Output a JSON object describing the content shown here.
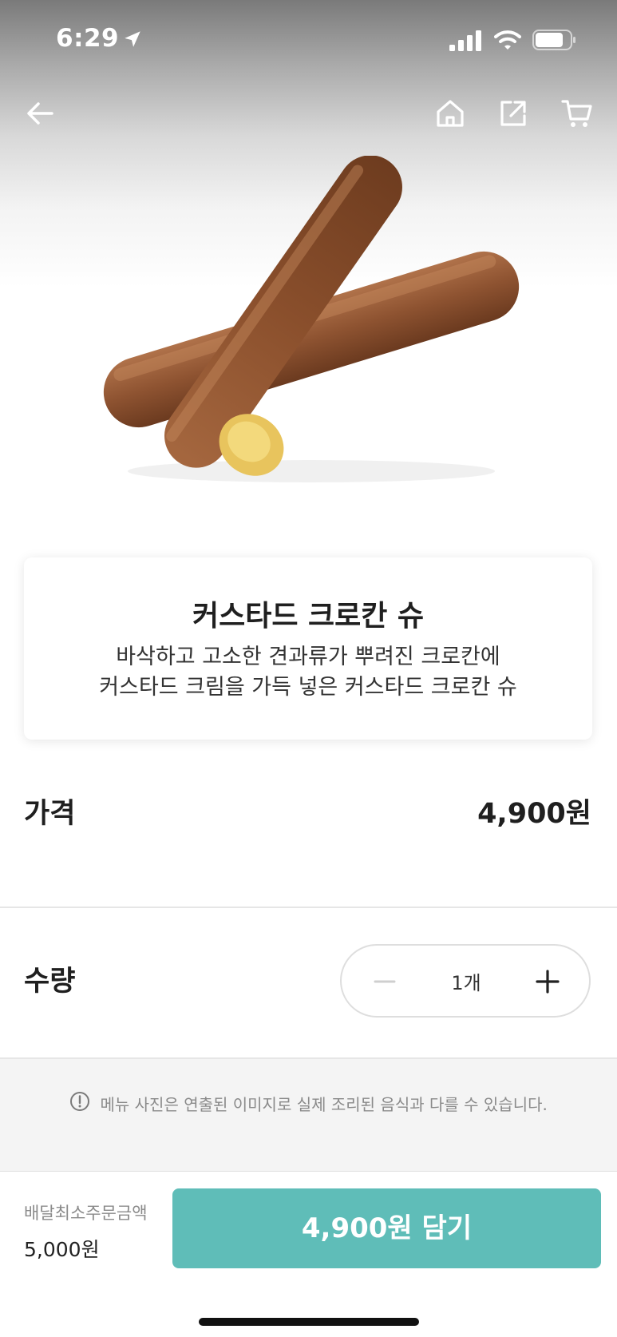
{
  "status_bar": {
    "time": "6:29",
    "icons": [
      "location-arrow-icon",
      "cellular-signal-icon",
      "wifi-icon",
      "battery-icon"
    ]
  },
  "nav": {
    "icons": [
      "back-arrow-icon",
      "home-icon",
      "share-icon",
      "cart-icon"
    ]
  },
  "product": {
    "name": "커스타드 크로칸 슈",
    "description_line1": "바삭하고 고소한 견과류가 뿌려진 크로칸에",
    "description_line2": "커스타드 크림을 가득 넣은 커스타드 크로칸 슈"
  },
  "price": {
    "label": "가격",
    "value": "4,900원"
  },
  "quantity": {
    "label": "수량",
    "value": "1개",
    "minus_icon": "minus-icon",
    "plus_icon": "plus-icon"
  },
  "notice": {
    "icon": "info-circle-icon",
    "text": "메뉴 사진은 연출된 이미지로 실제 조리된 음식과 다를 수 있습니다."
  },
  "footer": {
    "min_order_label": "배달최소주문금액",
    "min_order_value": "5,000원",
    "add_button_label": "4,900원 담기"
  },
  "colors": {
    "accent": "#5fbdb8",
    "text_primary": "#1f1f1f",
    "text_muted": "#8a8a8a"
  }
}
